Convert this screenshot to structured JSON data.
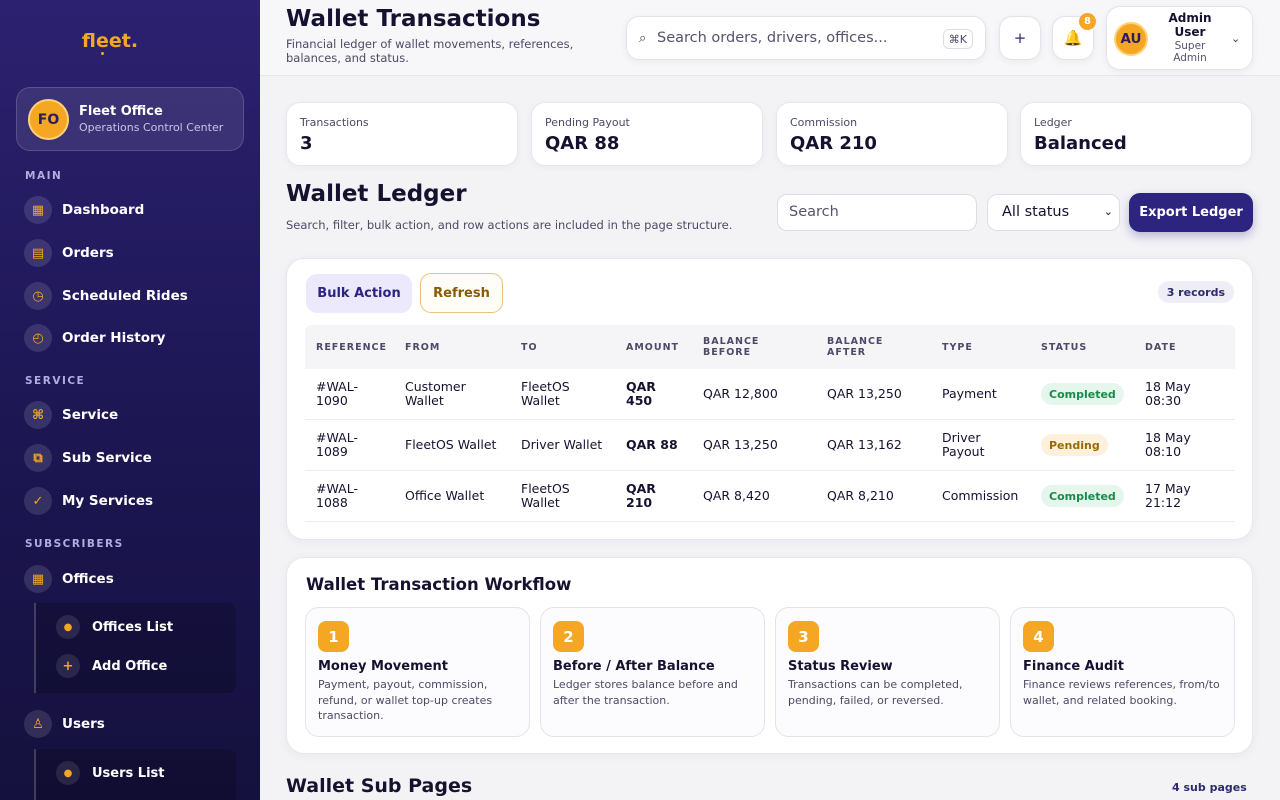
{
  "sidebar": {
    "logo": "fleet.",
    "office": {
      "initials": "FO",
      "name": "Fleet Office",
      "subtitle": "Operations Control Center"
    },
    "sections": {
      "main": "MAIN",
      "service": "SERVICE",
      "subscribers": "SUBSCRIBERS"
    },
    "items": {
      "dashboard": "Dashboard",
      "orders": "Orders",
      "scheduled_rides": "Scheduled Rides",
      "order_history": "Order History",
      "service": "Service",
      "sub_service": "Sub Service",
      "my_services": "My Services",
      "offices": "Offices",
      "offices_list": "Offices List",
      "add_office": "Add Office",
      "users": "Users",
      "users_list": "Users List"
    },
    "icons": {
      "dashboard": "grid-icon",
      "orders": "orders-icon",
      "scheduled_rides": "clock-icon",
      "order_history": "history-icon",
      "service": "command-icon",
      "sub_service": "layers-icon",
      "my_services": "check-icon",
      "offices": "building-icon",
      "offices_list": "dot-icon",
      "add_office": "plus-icon",
      "users": "user-icon",
      "users_list": "dot-icon"
    }
  },
  "header": {
    "title": "Wallet Transactions",
    "subtitle": "Financial ledger of wallet movements, references, balances, and status.",
    "search_placeholder": "Search orders, drivers, offices...",
    "search_shortcut": "⌘K",
    "add_label": "+",
    "notification_count": "8",
    "user": {
      "initials": "AU",
      "name": "Admin User",
      "role": "Super Admin"
    }
  },
  "stats": [
    {
      "label": "Transactions",
      "value": "3"
    },
    {
      "label": "Pending Payout",
      "value": "QAR 88"
    },
    {
      "label": "Commission",
      "value": "QAR 210"
    },
    {
      "label": "Ledger",
      "value": "Balanced"
    }
  ],
  "ledger": {
    "title": "Wallet Ledger",
    "subtitle": "Search, filter, bulk action, and row actions are included in the page structure.",
    "search_placeholder": "Search",
    "status_filter": "All status",
    "export_label": "Export Ledger",
    "bulk_label": "Bulk Action",
    "refresh_label": "Refresh",
    "records": "3 records",
    "columns": [
      "REFERENCE",
      "FROM",
      "TO",
      "AMOUNT",
      "BALANCE BEFORE",
      "BALANCE AFTER",
      "TYPE",
      "STATUS",
      "DATE"
    ],
    "rows": [
      {
        "reference": "#WAL-1090",
        "from": "Customer Wallet",
        "to": "FleetOS Wallet",
        "amount": "QAR 450",
        "before": "QAR 12,800",
        "after": "QAR 13,250",
        "type": "Payment",
        "status": "Completed",
        "date": "18 May 08:30"
      },
      {
        "reference": "#WAL-1089",
        "from": "FleetOS Wallet",
        "to": "Driver Wallet",
        "amount": "QAR 88",
        "before": "QAR 13,250",
        "after": "QAR 13,162",
        "type": "Driver Payout",
        "status": "Pending",
        "date": "18 May 08:10"
      },
      {
        "reference": "#WAL-1088",
        "from": "Office Wallet",
        "to": "FleetOS Wallet",
        "amount": "QAR 210",
        "before": "QAR 8,420",
        "after": "QAR 8,210",
        "type": "Commission",
        "status": "Completed",
        "date": "17 May 21:12"
      }
    ]
  },
  "workflow": {
    "title": "Wallet Transaction Workflow",
    "steps": [
      {
        "num": "1",
        "name": "Money Movement",
        "desc": "Payment, payout, commission, refund, or wallet top-up creates transaction."
      },
      {
        "num": "2",
        "name": "Before / After Balance",
        "desc": "Ledger stores balance before and after the transaction."
      },
      {
        "num": "3",
        "name": "Status Review",
        "desc": "Transactions can be completed, pending, failed, or reversed."
      },
      {
        "num": "4",
        "name": "Finance Audit",
        "desc": "Finance reviews references, from/to wallet, and related booking."
      }
    ]
  },
  "subpages": {
    "title": "Wallet Sub Pages",
    "count": "4 sub pages"
  },
  "colors": {
    "accent": "#f5a623",
    "brand": "#2d2480",
    "sidebar": "#1c1652",
    "completed": "#1a8a4a",
    "pending": "#9a6a00"
  }
}
